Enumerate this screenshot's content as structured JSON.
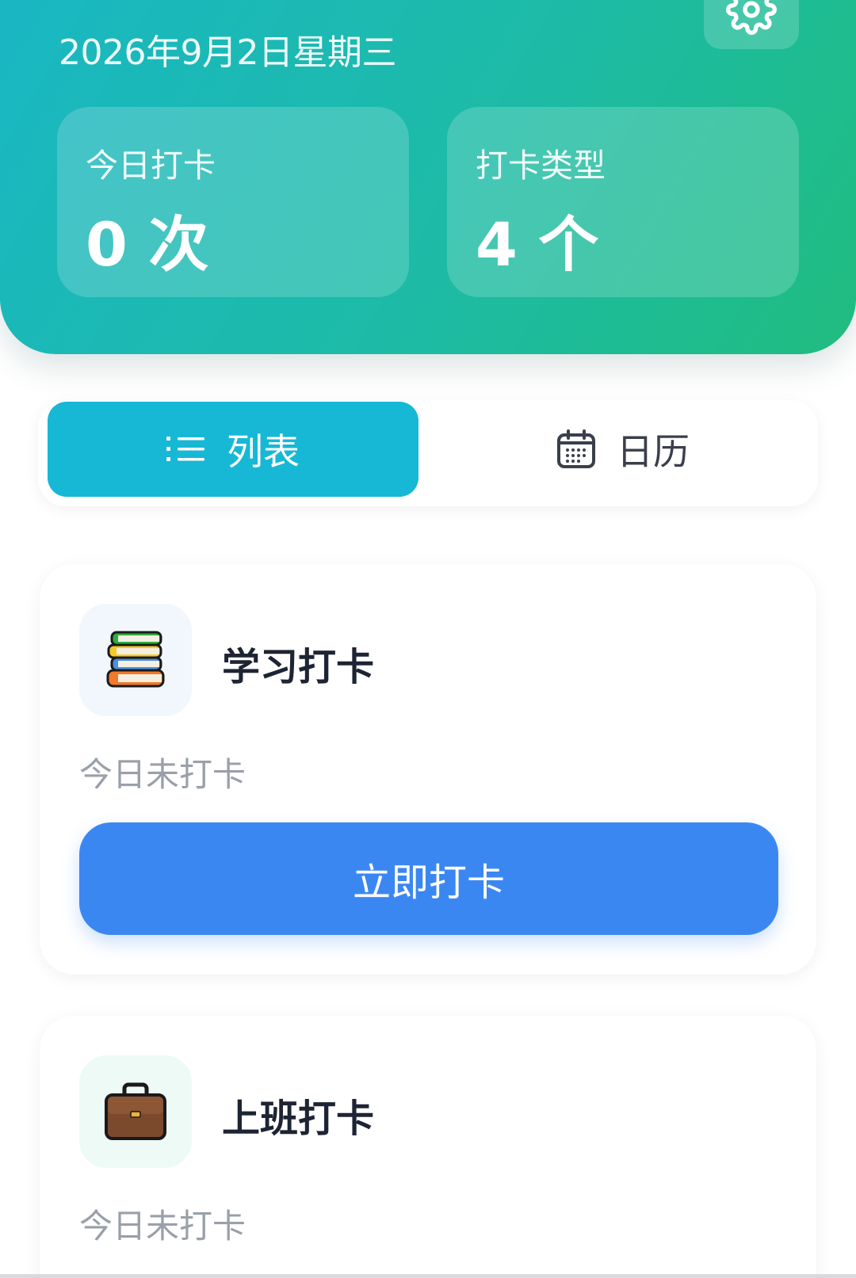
{
  "header": {
    "date": "2026年9月2日星期三",
    "stats": [
      {
        "label": "今日打卡",
        "value": "0 次"
      },
      {
        "label": "打卡类型",
        "value": "4 个"
      }
    ],
    "settings_icon": "gear-icon"
  },
  "view_toggle": {
    "list_label": "列表",
    "calendar_label": "日历",
    "active": "list"
  },
  "checkin_types": [
    {
      "icon": "books-icon",
      "title": "学习打卡",
      "status": "今日未打卡",
      "button": "立即打卡"
    },
    {
      "icon": "briefcase-icon",
      "title": "上班打卡",
      "status": "今日未打卡"
    }
  ],
  "colors": {
    "header_gradient": [
      "#1ab7c3",
      "#20bc80"
    ],
    "active_tab": "#17b8d5",
    "primary_button": "#3b87f2"
  }
}
